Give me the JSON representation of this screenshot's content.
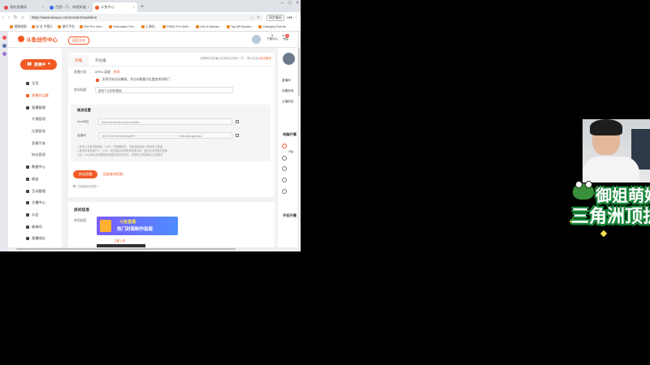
{
  "browser": {
    "tabs": [
      {
        "label": "我的直播间",
        "fav_color": "#e34d4d"
      },
      {
        "label": "百度一下，你就知道",
        "fav_color": "#3a6fe8"
      },
      {
        "label": "斗鱼中心",
        "fav_color": "#f15a24"
      }
    ],
    "new_tab": "+",
    "url": "https://www.douyu.com/creator/main/live",
    "tools": [
      "☆",
      "✎"
    ],
    "tabs_button": "同步备份",
    "ai_label": "AI▾",
    "bookmarks": [
      "搜狗地图",
      "必 全 中国人",
      "旅行平台",
      "HW Pro Usb...",
      "Overwatch Pro...",
      "上海光...",
      "PUBG Pro Setti...",
      "Grid & Mouse...",
      "Top AR Bookin...",
      "Category Events"
    ]
  },
  "site": {
    "logo": "斗鱼创作中心",
    "switch_label": "返回主站",
    "download_label": "下载中心",
    "message_label": "消息",
    "message_badge": "99"
  },
  "sidebar": {
    "live_button": "直播中",
    "items": [
      {
        "label": "主页",
        "sub": false,
        "active": false
      },
      {
        "label": "直播作品集",
        "sub": false,
        "active": true
      },
      {
        "label": "直播管理",
        "sub": false,
        "active": false
      },
      {
        "label": "开播管理",
        "sub": true,
        "active": false
      },
      {
        "label": "比赛管理",
        "sub": true,
        "active": false
      },
      {
        "label": "直播手册",
        "sub": true,
        "active": false
      },
      {
        "label": "粉丝管理",
        "sub": true,
        "active": false
      },
      {
        "label": "数据中心",
        "sub": false,
        "active": false
      },
      {
        "label": "收益",
        "sub": false,
        "active": false
      },
      {
        "label": "互动管理",
        "sub": false,
        "active": false
      },
      {
        "label": "主播中心",
        "sub": false,
        "active": false
      },
      {
        "label": "公会",
        "sub": false,
        "active": false
      },
      {
        "label": "装修间",
        "sub": false,
        "active": false
      },
      {
        "label": "直播成长",
        "sub": false,
        "active": false
      }
    ]
  },
  "main": {
    "tabs": [
      "开播",
      "开位播"
    ],
    "tab_note": "如需修改直播分区请前往操作一栏，需以旧版",
    "tab_note_link": "前往修改 ›",
    "category_label": "直播分类",
    "category_value": "APEX 英雄",
    "category_change": "修改",
    "auto_check": "实时开启自动撤离，并自动根据分区重加房间热门",
    "title_label": "房间标题",
    "title_value": "蓝色下山射粉蛋面",
    "settings_title": "推流设置",
    "rtmp_label": "rtmp地址",
    "rtmp_value": "rtmp://sendtc3a.douyu.com/live",
    "key_label": "直播码",
    "key_value": "1847372rIPs9DIrDdDtqRR················································?edbodsk.signflow=",
    "notes": [
      "1.复制上方推流配置到（OBS）的直播码处，不能泄露给他人使用防止被盗",
      "2.推流码有效期为十二小时，如关播后需重新获取推流码，推流后请勿随意更换",
      "注意：rtmp地址会根据推流线路的变化而变化，重播前请重新确认后再推流"
    ],
    "close_button": "关闭直播",
    "apply_link": "回放查询权限›",
    "agree_text": "已阅读协议须知 ?",
    "room_info_title": "房间信息",
    "cover_label": "房间封面",
    "banner_line1": "斗鱼直播",
    "banner_line2": "热门封面制作指南",
    "upload_link": "立即上传"
  },
  "right_panel": {
    "items": [
      "直播间",
      "设置房间",
      "主播权益"
    ],
    "section1": "电脑开播",
    "section2": "手机开播",
    "side_item": "开播"
  },
  "stream_overlay": {
    "line1": "御姐萌妹",
    "line2": "三角洲顶护"
  }
}
